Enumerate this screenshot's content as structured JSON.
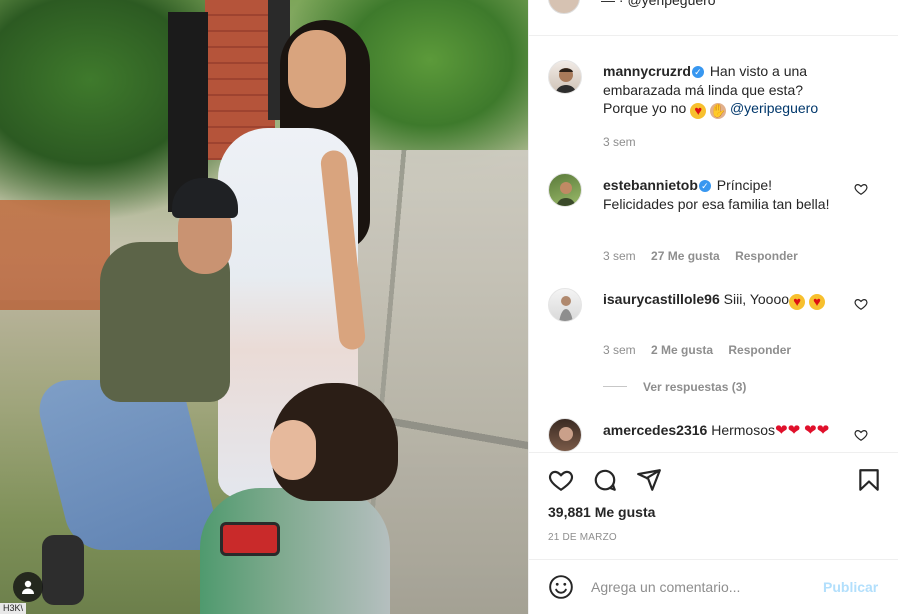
{
  "photo": {
    "user_tag_label": "tagged-users",
    "partial_tag_text": "H3K\\"
  },
  "header_peek": {
    "partial_text": "— · @yeripeguero"
  },
  "comments": [
    {
      "username": "mannycruzrd",
      "verified": true,
      "text": "Han visto a una embarazada má linda que esta? Porque yo no",
      "emojis": [
        "heart-eyes",
        "raised-hands"
      ],
      "mention": "@yeripeguero",
      "time": "3 sem"
    },
    {
      "username": "estebannietob",
      "verified": true,
      "text": "Príncipe! Felicidades por esa familia tan bella!",
      "time": "3 sem",
      "likes": "27 Me gusta",
      "reply": "Responder"
    },
    {
      "username": "isaurycastillole96",
      "verified": false,
      "text": "Siii, Yoooo",
      "emojis": [
        "heart-eyes",
        "heart-eyes"
      ],
      "time": "3 sem",
      "likes": "2 Me gusta",
      "reply": "Responder",
      "view_replies": "Ver respuestas (3)"
    },
    {
      "username": "amercedes2316",
      "verified": false,
      "text": "Hermosos",
      "emojis": [
        "red-heart",
        "red-heart",
        "red-heart",
        "red-heart"
      ]
    }
  ],
  "actions": {
    "like_count": "39,881 Me gusta",
    "date": "21 DE MARZO"
  },
  "add_comment": {
    "placeholder": "Agrega un comentario...",
    "publish_label": "Publicar"
  },
  "colors": {
    "verified": "#3897f0",
    "mention": "#00376b",
    "muted": "#8e8e8e",
    "publish_disabled": "#b2dffc"
  }
}
